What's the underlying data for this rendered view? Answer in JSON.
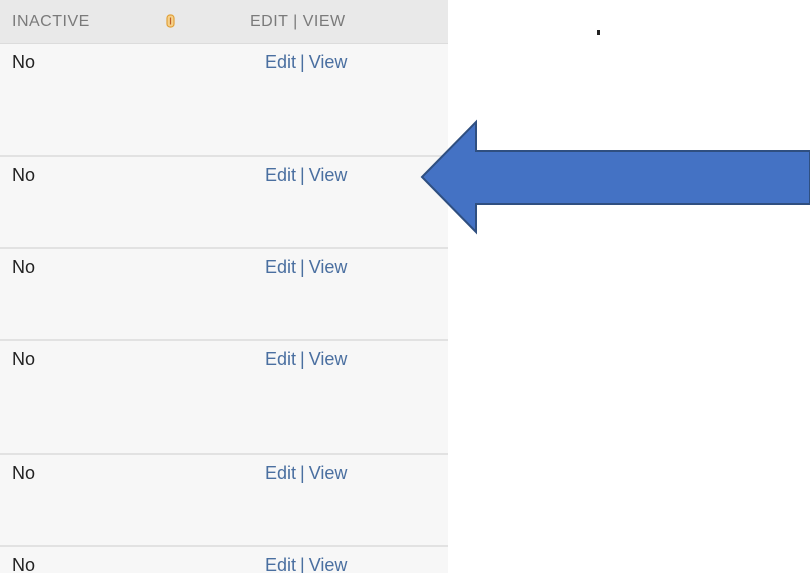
{
  "table": {
    "columns": [
      {
        "label": "INACTIVE"
      },
      {
        "label": "EDIT | VIEW"
      }
    ],
    "rows": [
      {
        "inactive": "No",
        "edit_label": "Edit",
        "separator": "|",
        "view_label": "View"
      },
      {
        "inactive": "No",
        "edit_label": "Edit",
        "separator": "|",
        "view_label": "View"
      },
      {
        "inactive": "No",
        "edit_label": "Edit",
        "separator": "|",
        "view_label": "View"
      },
      {
        "inactive": "No",
        "edit_label": "Edit",
        "separator": "|",
        "view_label": "View"
      },
      {
        "inactive": "No",
        "edit_label": "Edit",
        "separator": "|",
        "view_label": "View"
      },
      {
        "inactive": "No",
        "edit_label": "Edit",
        "separator": "|",
        "view_label": "View"
      }
    ]
  },
  "icons": {
    "sort": "sort-icon",
    "arrow": "left-arrow-icon"
  },
  "colors": {
    "arrow_fill": "#4472c4",
    "arrow_stroke": "#2f4f80",
    "link": "#4a6fa0",
    "header_bg": "#e9e9e9",
    "row_bg": "#f7f7f7",
    "sort_icon": "#e0a03a"
  }
}
